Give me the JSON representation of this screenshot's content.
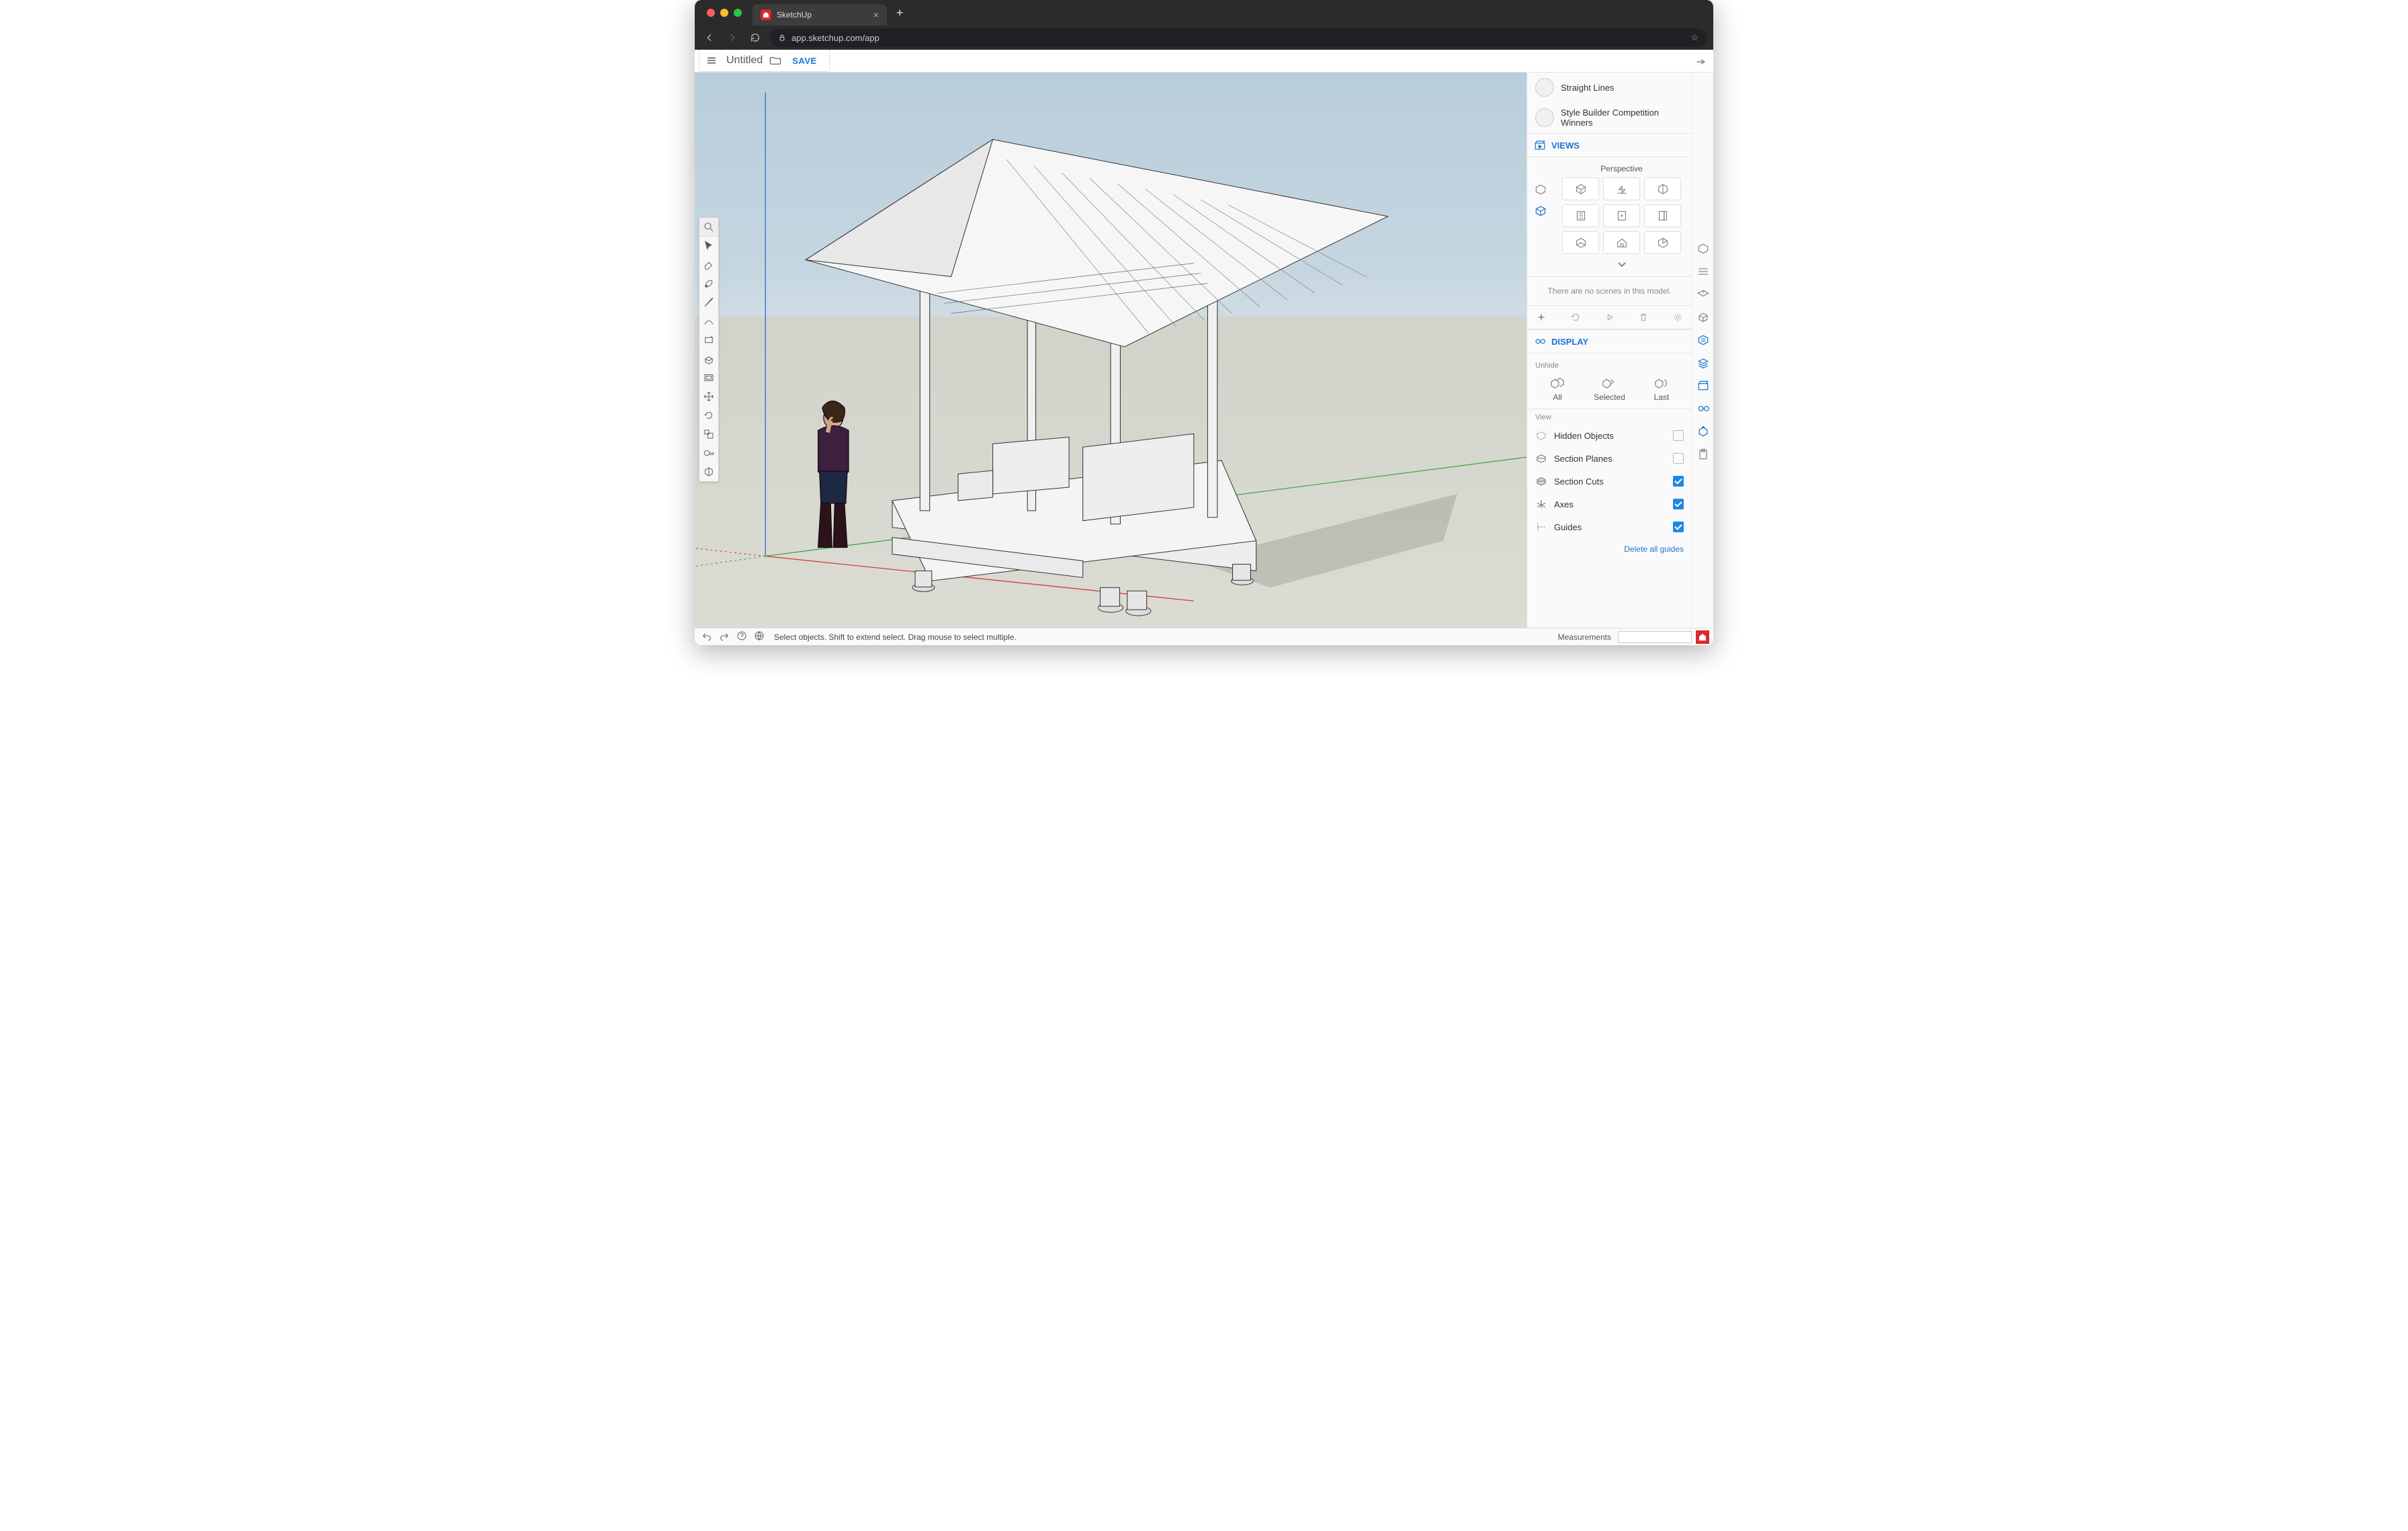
{
  "browser": {
    "tab_title": "SketchUp",
    "url": "app.sketchup.com/app"
  },
  "header": {
    "file_title": "Untitled",
    "save_label": "SAVE"
  },
  "tools": [
    "search",
    "select",
    "eraser",
    "paint",
    "line",
    "arc",
    "shape",
    "pushpull",
    "offset",
    "move",
    "rotate",
    "scale",
    "tape",
    "text"
  ],
  "styles": {
    "items": [
      {
        "label": "Straight Lines"
      },
      {
        "label": "Style Builder Competition Winners"
      }
    ]
  },
  "views": {
    "section_title": "VIEWS",
    "perspective_label": "Perspective",
    "no_scenes_text": "There are no scenes in this model."
  },
  "display": {
    "section_title": "DISPLAY",
    "unhide_label": "Unhide",
    "unhide": {
      "all": "All",
      "selected": "Selected",
      "last": "Last"
    },
    "view_label": "View",
    "options": {
      "hidden_objects": {
        "label": "Hidden Objects",
        "checked": false
      },
      "section_planes": {
        "label": "Section Planes",
        "checked": false
      },
      "section_cuts": {
        "label": "Section Cuts",
        "checked": true
      },
      "axes": {
        "label": "Axes",
        "checked": true
      },
      "guides": {
        "label": "Guides",
        "checked": true
      }
    },
    "delete_guides": "Delete all guides"
  },
  "status": {
    "hint": "Select objects. Shift to extend select. Drag mouse to select multiple.",
    "measurements_label": "Measurements",
    "measurements_value": ""
  }
}
